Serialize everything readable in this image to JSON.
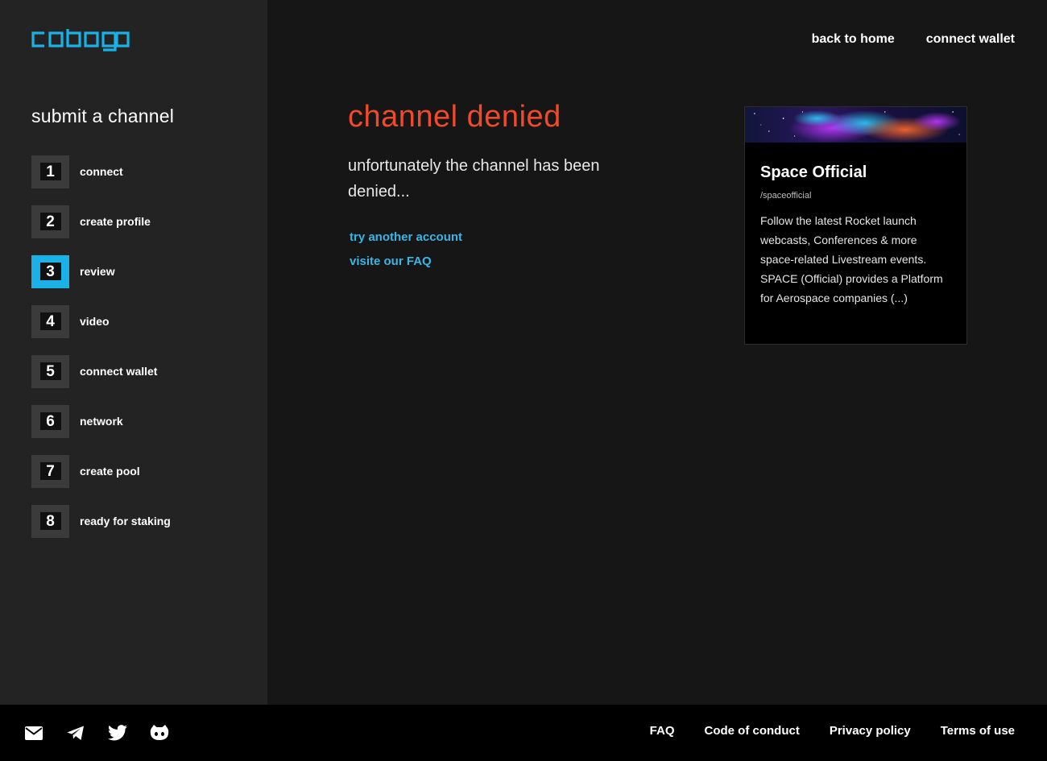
{
  "brand": {
    "logo_text": "cobogo",
    "accent_color": "#1ab1e6",
    "denied_color": "#f04a2a"
  },
  "header": {
    "nav": [
      {
        "label": "back to home"
      },
      {
        "label": "connect wallet"
      }
    ]
  },
  "sidebar": {
    "title": "submit a channel",
    "steps": [
      {
        "number": "1",
        "label": "connect",
        "active": false
      },
      {
        "number": "2",
        "label": "create profile",
        "active": false
      },
      {
        "number": "3",
        "label": "review",
        "active": true
      },
      {
        "number": "4",
        "label": "video",
        "active": false
      },
      {
        "number": "5",
        "label": "connect wallet",
        "active": false
      },
      {
        "number": "6",
        "label": "network",
        "active": false
      },
      {
        "number": "7",
        "label": "create pool",
        "active": false
      },
      {
        "number": "8",
        "label": "ready for staking",
        "active": false
      }
    ]
  },
  "main": {
    "title": "channel denied",
    "description": "unfortunately the channel has been denied...",
    "links": [
      {
        "label": "try another account"
      },
      {
        "label": "visite our FAQ"
      }
    ]
  },
  "card": {
    "title": "Space Official",
    "handle": "/spaceofficial",
    "description": "Follow the latest Rocket launch webcasts, Conferences & more space-related Livestream events. SPACE (Official) provides a Platform for Aerospace companies (...)"
  },
  "footer": {
    "social_icons": [
      "mail-icon",
      "telegram-icon",
      "twitter-icon",
      "github-icon"
    ],
    "links": [
      {
        "label": "FAQ"
      },
      {
        "label": "Code of conduct"
      },
      {
        "label": "Privacy policy"
      },
      {
        "label": "Terms of use"
      }
    ]
  }
}
